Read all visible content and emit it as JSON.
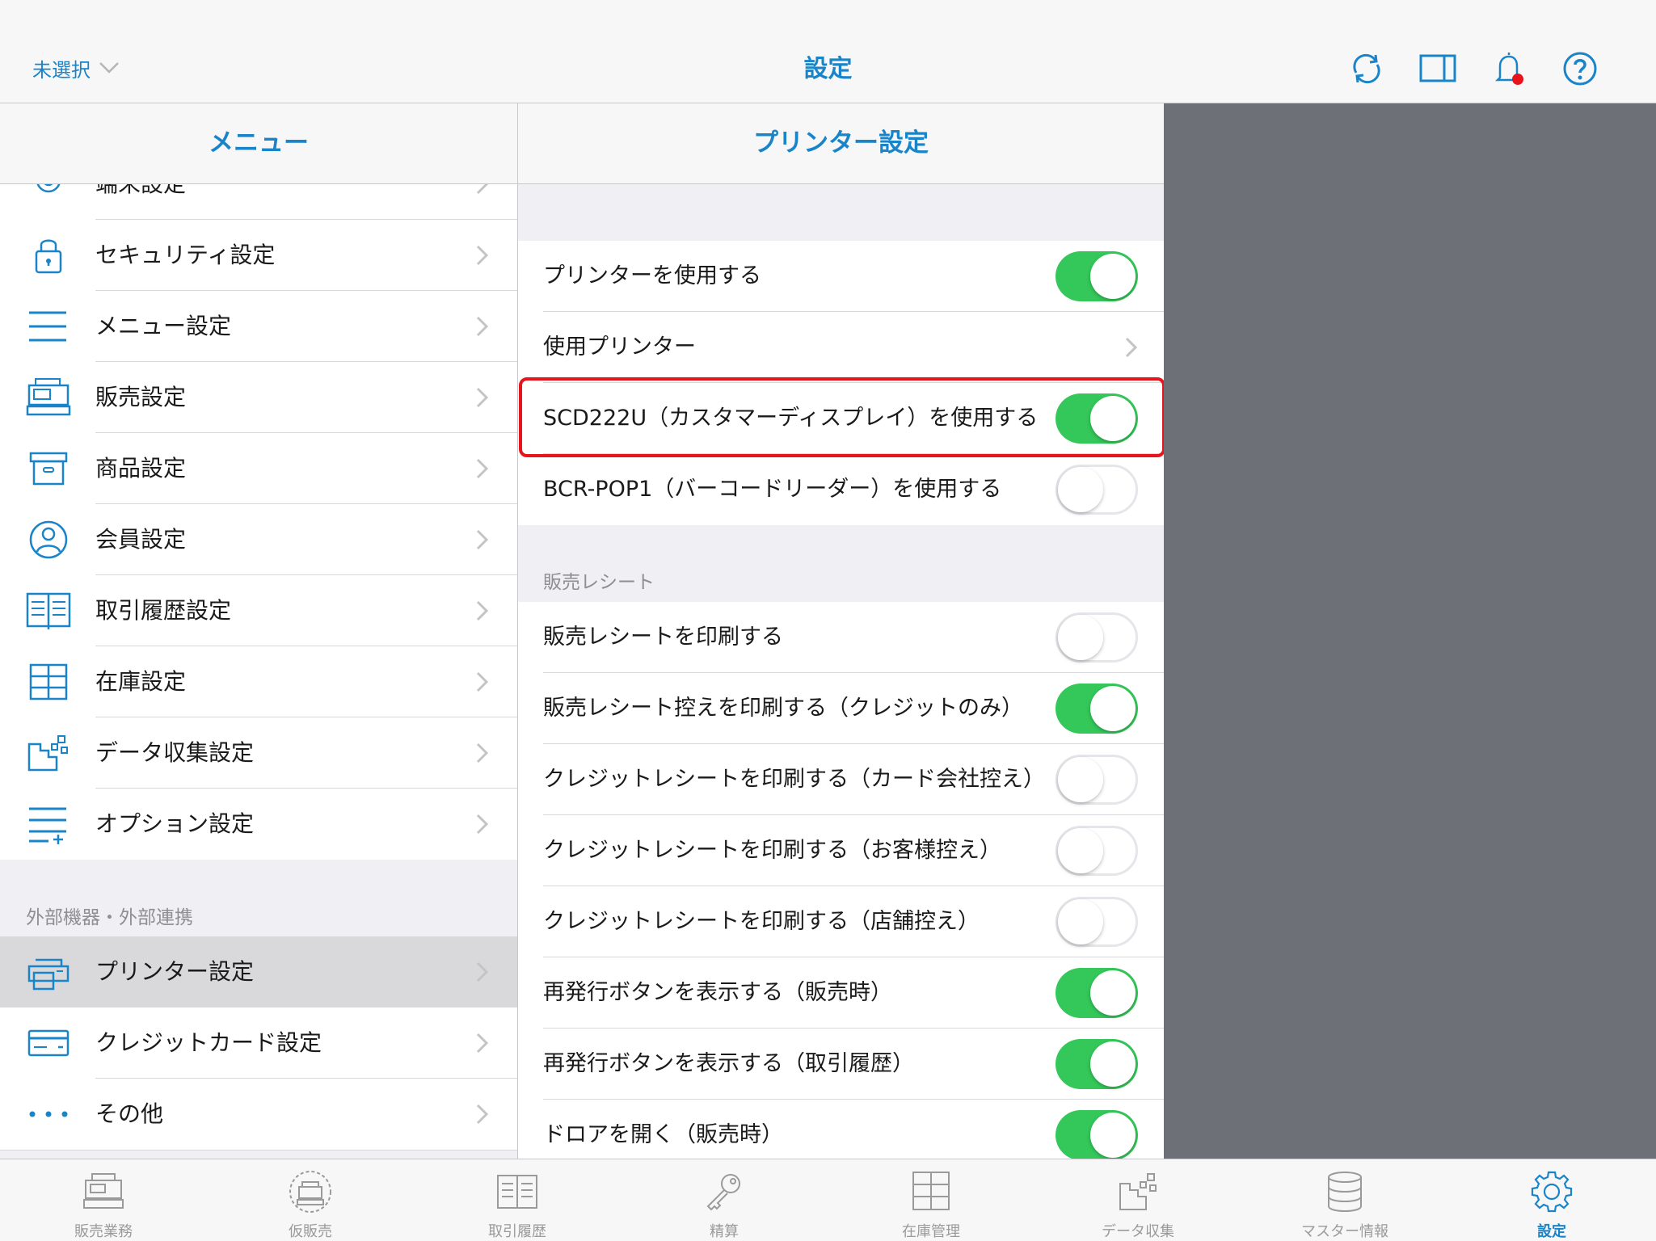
{
  "topbar": {
    "store_selector": "未選択",
    "title": "設定",
    "icons": [
      "refresh-icon",
      "split-view-icon",
      "bell-icon",
      "help-icon"
    ]
  },
  "menu": {
    "header": "メニュー",
    "partial_item": "端末設定",
    "items": [
      {
        "label": "セキュリティ設定",
        "icon": "lock-icon"
      },
      {
        "label": "メニュー設定",
        "icon": "menu-lines-icon"
      },
      {
        "label": "販売設定",
        "icon": "register-icon"
      },
      {
        "label": "商品設定",
        "icon": "box-icon"
      },
      {
        "label": "会員設定",
        "icon": "person-icon"
      },
      {
        "label": "取引履歴設定",
        "icon": "book-icon"
      },
      {
        "label": "在庫設定",
        "icon": "shelves-icon"
      },
      {
        "label": "データ収集設定",
        "icon": "data-collect-icon"
      },
      {
        "label": "オプション設定",
        "icon": "options-icon"
      }
    ],
    "section_title": "外部機器・外部連携",
    "external_items": [
      {
        "label": "プリンター設定",
        "icon": "printer-icon",
        "selected": true
      },
      {
        "label": "クレジットカード設定",
        "icon": "credit-card-icon"
      },
      {
        "label": "その他",
        "icon": "more-icon"
      }
    ]
  },
  "printer": {
    "header": "プリンター設定",
    "use_printer": {
      "label": "プリンターを使用する",
      "on": true
    },
    "printer_select": {
      "label": "使用プリンター"
    },
    "scd_display": {
      "label": "SCD222U（カスタマーディスプレイ）を使用する",
      "on": true
    },
    "bcr_reader": {
      "label": "BCR-POP1（バーコードリーダー）を使用する",
      "on": false
    },
    "section_title": "販売レシート",
    "receipt_options": [
      {
        "label": "販売レシートを印刷する",
        "on": false
      },
      {
        "label": "販売レシート控えを印刷する（クレジットのみ）",
        "on": true
      },
      {
        "label": "クレジットレシートを印刷する（カード会社控え）",
        "on": false
      },
      {
        "label": "クレジットレシートを印刷する（お客様控え）",
        "on": false
      },
      {
        "label": "クレジットレシートを印刷する（店舗控え）",
        "on": false
      },
      {
        "label": "再発行ボタンを表示する（販売時）",
        "on": true
      },
      {
        "label": "再発行ボタンを表示する（取引履歴）",
        "on": true
      },
      {
        "label": "ドロアを開く（販売時）",
        "on": true
      }
    ]
  },
  "tabbar": {
    "tabs": [
      {
        "label": "販売業務",
        "icon": "register-icon"
      },
      {
        "label": "仮販売",
        "icon": "temp-sale-icon"
      },
      {
        "label": "取引履歴",
        "icon": "book-icon"
      },
      {
        "label": "精算",
        "icon": "key-icon"
      },
      {
        "label": "在庫管理",
        "icon": "shelves-icon"
      },
      {
        "label": "データ収集",
        "icon": "data-collect-icon"
      },
      {
        "label": "マスター情報",
        "icon": "database-icon"
      },
      {
        "label": "設定",
        "icon": "gear-icon",
        "active": true
      }
    ]
  },
  "colors": {
    "accent": "#1a84c9",
    "toggle_on": "#34c759",
    "highlight": "#e8141c",
    "gray_pane": "#6e7077"
  }
}
